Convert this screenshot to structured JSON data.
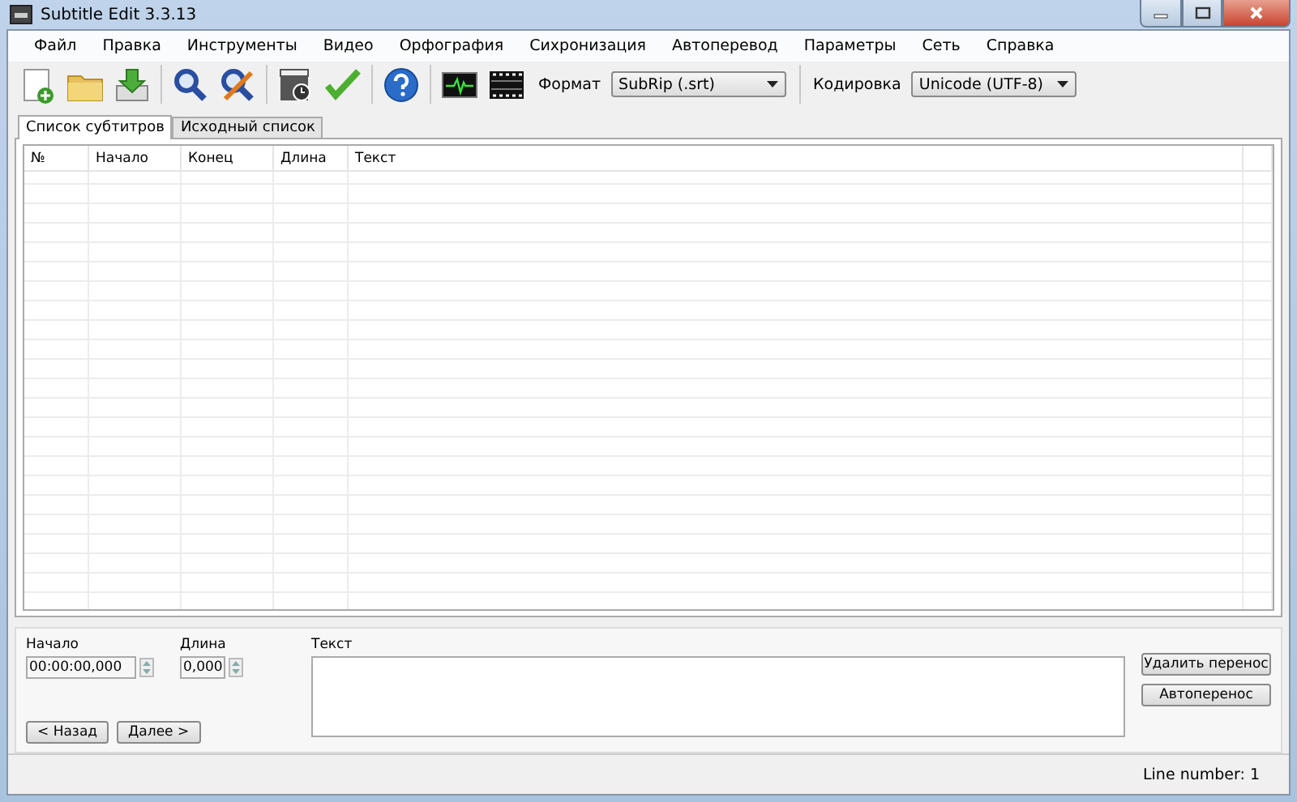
{
  "window": {
    "title": "Subtitle Edit 3.3.13"
  },
  "menu": [
    "Файл",
    "Правка",
    "Инструменты",
    "Видео",
    "Орфография",
    "Сихронизация",
    "Автоперевод",
    "Параметры",
    "Сеть",
    "Справка"
  ],
  "toolbar": {
    "buttons": [
      {
        "kind": "new"
      },
      {
        "kind": "open"
      },
      {
        "kind": "download"
      },
      {
        "kind": "sep"
      },
      {
        "kind": "search"
      },
      {
        "kind": "replace"
      },
      {
        "kind": "sep"
      },
      {
        "kind": "video"
      },
      {
        "kind": "check"
      },
      {
        "kind": "sep"
      },
      {
        "kind": "help"
      },
      {
        "kind": "sep"
      },
      {
        "kind": "wave"
      },
      {
        "kind": "film"
      }
    ],
    "format_label": "Формат",
    "format_value": "SubRip (.srt)",
    "encoding_label": "Кодировка",
    "encoding_value": "Unicode (UTF-8)"
  },
  "tabs": [
    {
      "label": "Список субтитров",
      "selected": true
    },
    {
      "label": "Исходный список",
      "selected": false
    }
  ],
  "table": {
    "columns": [
      "№",
      "Начало",
      "Конец",
      "Длина",
      "Текст"
    ]
  },
  "editor": {
    "start_label": "Начало",
    "start_value": "00:00:00,000",
    "duration_label": "Длина",
    "duration_value": "0,000",
    "text_label": "Текст",
    "prev_button": "< Назад",
    "next_button": "Далее >",
    "side_buttons": [
      "Удалить перенос",
      "Автоперенос"
    ]
  },
  "status_bar": {
    "text": "Line number: 1"
  }
}
